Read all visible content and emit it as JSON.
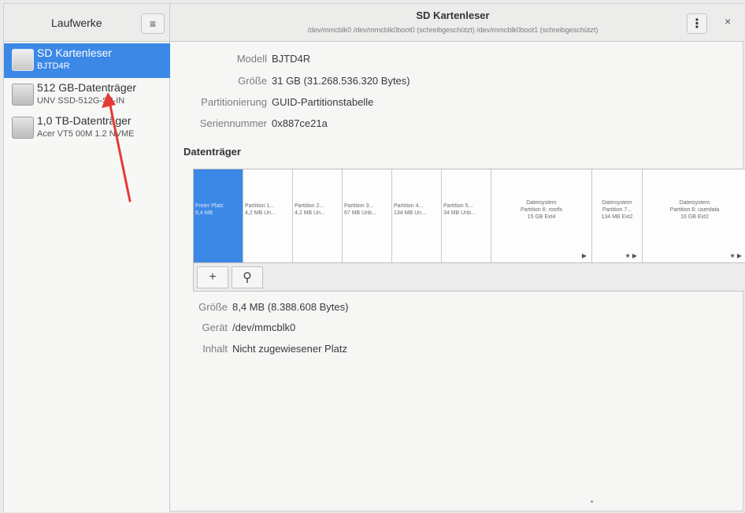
{
  "header": {
    "sidebar_title": "Laufwerke",
    "title": "SD Kartenleser",
    "subtitle": "/dev/mmcblk0 /dev/mmcblk0boot0 (schreibgeschützt) /dev/mmcblk0boot1 (schreibgeschützt)",
    "hamburger_glyph": "≡",
    "menu_glyph": "⋮",
    "close_glyph": "×"
  },
  "sidebar": {
    "drives": [
      {
        "name": "SD Kartenleser",
        "sub": "BJTD4R",
        "selected": true
      },
      {
        "name": "512 GB-Datenträger",
        "sub": "UNV SSD-512G-S3-IN",
        "selected": false
      },
      {
        "name": "1,0 TB-Datenträger",
        "sub": "Acer VT5 00M 1.2 NVME",
        "selected": false
      }
    ]
  },
  "device": {
    "model_label": "Modell",
    "model_value": "BJTD4R",
    "size_label": "Größe",
    "size_value": "31 GB (31.268.536.320 Bytes)",
    "partitioning_label": "Partitionierung",
    "partitioning_value": "GUID-Partitionstabelle",
    "serial_label": "Seriennummer",
    "serial_value": "0x887ce21a"
  },
  "volumes_title": "Datenträger",
  "volumes": [
    {
      "line1": "Freier Platz",
      "line2": "8,4 MB",
      "line3": ""
    },
    {
      "line1": "Partition 1...",
      "line2": "4,2 MB Un...",
      "line3": ""
    },
    {
      "line1": "Partition 2...",
      "line2": "4,2 MB Un...",
      "line3": ""
    },
    {
      "line1": "Partition 3...",
      "line2": "67 MB Unb...",
      "line3": ""
    },
    {
      "line1": "Partition 4...",
      "line2": "134 MB Un...",
      "line3": ""
    },
    {
      "line1": "Partition 5...",
      "line2": "34 MB Unb...",
      "line3": ""
    },
    {
      "line1": "Dateisystem",
      "line2": "Partition 6: rootfs",
      "line3": "15 GB Ext4",
      "marks": "▶"
    },
    {
      "line1": "Dateisystem",
      "line2": "Partition 7...",
      "line3": "134 MB Ext2",
      "marks": "★ ▶"
    },
    {
      "line1": "Dateisystem",
      "line2": "Partition 8: userdata",
      "line3": "16 GB Ext2",
      "marks": "★ ▶"
    }
  ],
  "toolbar": {
    "add_glyph": "+",
    "settings_glyph": "⚲"
  },
  "selected_volume": {
    "size_label": "Größe",
    "size_value": "8,4 MB (8.388.608 Bytes)",
    "device_label": "Gerät",
    "device_value": "/dev/mmcblk0",
    "content_label": "Inhalt",
    "content_value": "Nicht zugewiesener Platz"
  }
}
